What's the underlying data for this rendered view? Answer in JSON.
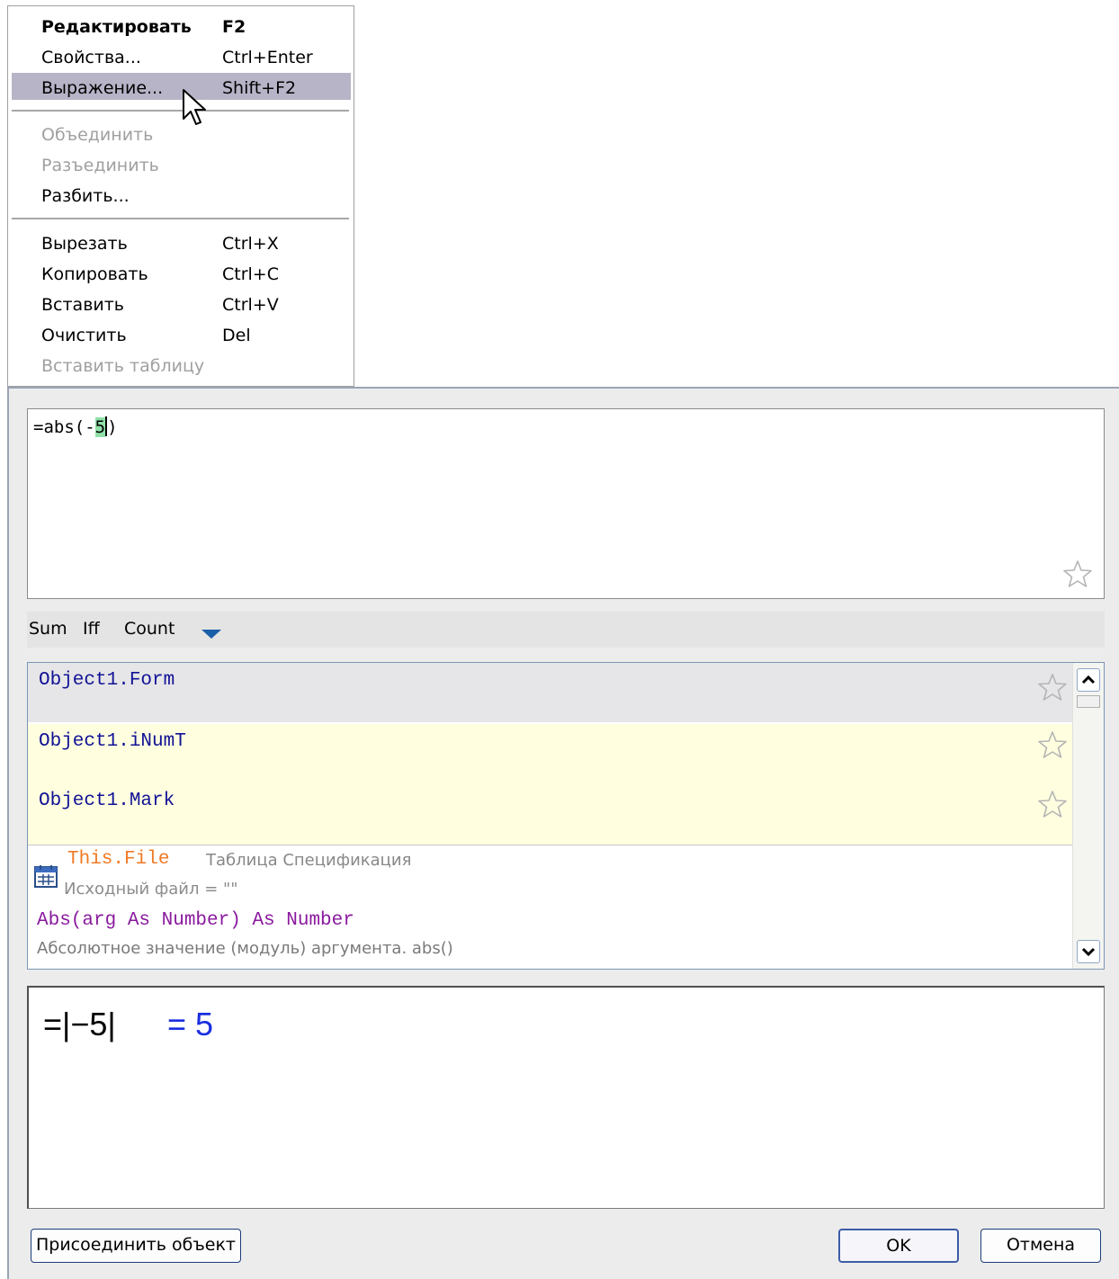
{
  "context_menu": {
    "items": [
      {
        "label": "Редактировать",
        "shortcut": "F2"
      },
      {
        "label": "Свойства...",
        "shortcut": "Ctrl+Enter"
      },
      {
        "label": "Выражение...",
        "shortcut": "Shift+F2"
      },
      {
        "label": "Объединить"
      },
      {
        "label": "Разъединить"
      },
      {
        "label": "Разбить..."
      },
      {
        "label": "Вырезать",
        "shortcut": "Ctrl+X"
      },
      {
        "label": "Копировать",
        "shortcut": "Ctrl+C"
      },
      {
        "label": "Вставить",
        "shortcut": "Ctrl+V"
      },
      {
        "label": "Очистить",
        "shortcut": "Del"
      },
      {
        "label": "Вставить таблицу"
      }
    ]
  },
  "expression": {
    "prefix": "=abs(-",
    "highlighted": "5",
    "suffix": ")"
  },
  "toolbar": {
    "items": [
      "Sum",
      "Iff",
      "Count"
    ]
  },
  "list": {
    "items": [
      "Object1.Form",
      "Object1.iNumT",
      "Object1.Mark"
    ],
    "hint": {
      "object": "This.File",
      "table": "Таблица Спецификация",
      "source": "Исходный файл = \"\"",
      "function": "Abs(arg As Number) As Number",
      "description": "Абсолютное значение (модуль) аргумента. abs()"
    }
  },
  "result": {
    "expression": "=|−5|",
    "value": "= 5"
  },
  "buttons": {
    "attach": "Присоединить объект",
    "ok": "OK",
    "cancel": "Отмена"
  }
}
